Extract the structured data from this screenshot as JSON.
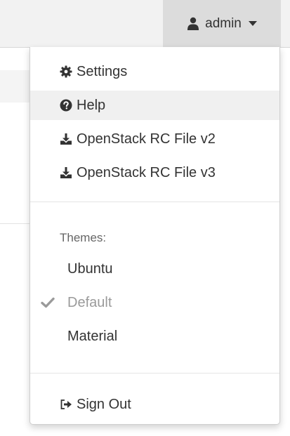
{
  "navbar": {
    "user_label": "admin",
    "user_icon": "user-icon",
    "caret_icon": "caret-down-icon"
  },
  "menu": {
    "items": [
      {
        "label": "Settings",
        "icon": "gear-icon"
      },
      {
        "label": "Help",
        "icon": "question-circle-icon"
      },
      {
        "label": "OpenStack RC File v2",
        "icon": "download-icon"
      },
      {
        "label": "OpenStack RC File v3",
        "icon": "download-icon"
      }
    ],
    "themes_header": "Themes:",
    "themes": [
      {
        "label": "Ubuntu",
        "selected": false
      },
      {
        "label": "Default",
        "selected": true
      },
      {
        "label": "Material",
        "selected": false
      }
    ],
    "sign_out": {
      "label": "Sign Out",
      "icon": "sign-out-icon"
    }
  },
  "colors": {
    "navbar_bg": "#f2f2f2",
    "toggle_bg": "#dcdcdc",
    "active_item_bg": "#f0f0f0",
    "muted_text": "#9a9a9a"
  }
}
